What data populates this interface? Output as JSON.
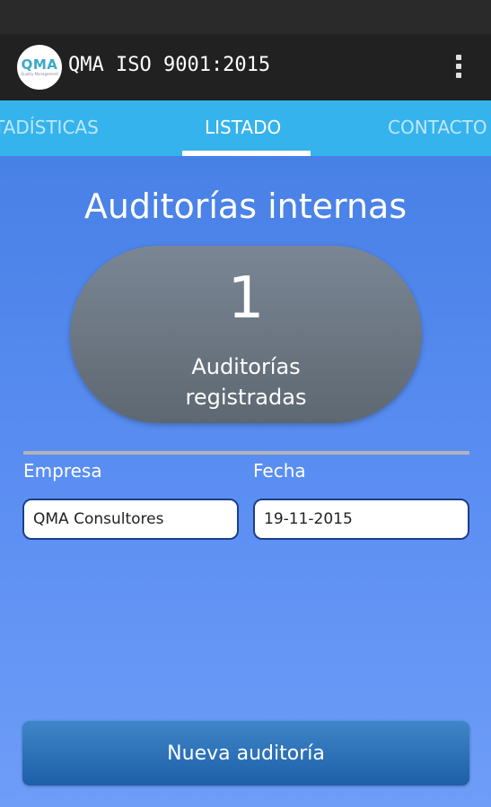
{
  "app": {
    "title": "QMA ISO 9001:2015",
    "logo_text": "QMA",
    "logo_subtext": "Quality Management"
  },
  "tabs": [
    {
      "label": "TADÍSTICAS",
      "active": false
    },
    {
      "label": "LISTADO",
      "active": true
    },
    {
      "label": "CONTACTO",
      "active": false
    }
  ],
  "main": {
    "section_title": "Auditorías internas",
    "count": "1",
    "count_label_line1": "Auditorías",
    "count_label_line2": "registradas"
  },
  "list": {
    "col_empresa": "Empresa",
    "col_fecha": "Fecha",
    "rows": [
      {
        "empresa": "QMA Consultores",
        "fecha": "19-11-2015"
      }
    ]
  },
  "actions": {
    "new_audit": "Nueva auditoría"
  },
  "colors": {
    "tab_bar": "#35b3ec",
    "app_bar": "#212121",
    "background_top": "#3f7ae0",
    "background_bottom": "#6e9df8",
    "pill": "#6b7580",
    "button": "#2a6fb8"
  },
  "icons": {
    "menu": "overflow-menu-icon",
    "logo": "qma-logo-icon"
  }
}
